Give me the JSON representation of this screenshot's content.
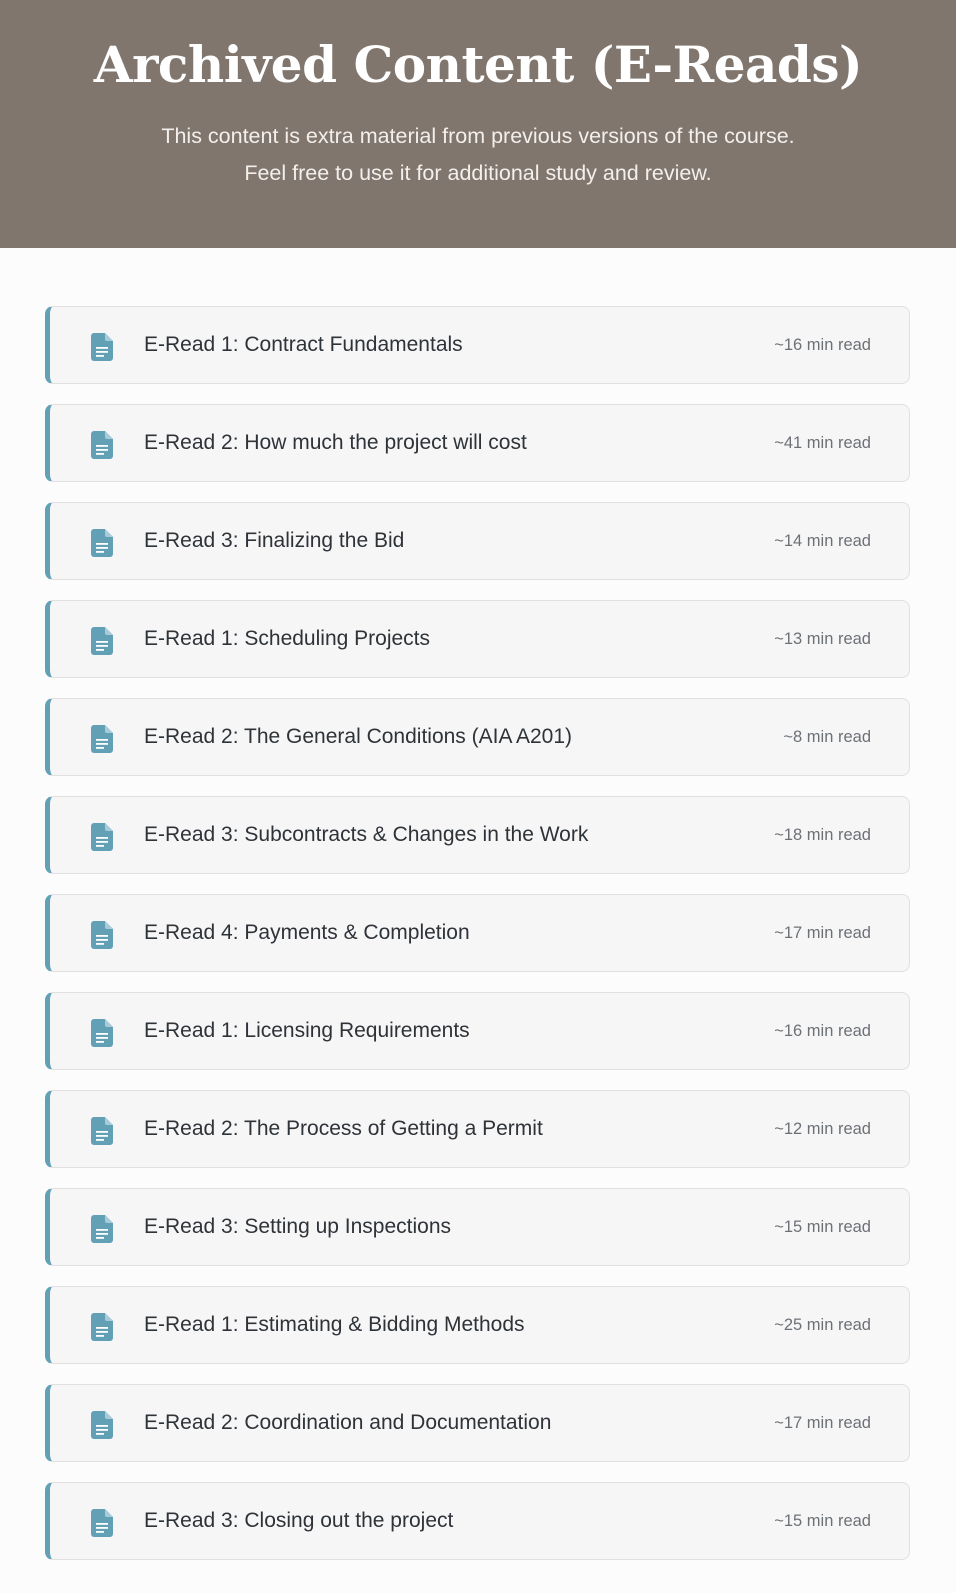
{
  "header": {
    "title": "Archived Content (E-Reads)",
    "subtitle_line1": "This content is extra material from previous versions of the course.",
    "subtitle_line2": "Feel free to use it for additional study and review."
  },
  "colors": {
    "header_bg": "#80766d",
    "accent": "#62a0b6",
    "card_bg": "#f7f6f7"
  },
  "items": [
    {
      "icon": "document-icon",
      "title": "E-Read 1: Contract Fundamentals",
      "time": "~16 min read"
    },
    {
      "icon": "document-icon",
      "title": "E-Read 2: How much the project will cost",
      "time": "~41 min read"
    },
    {
      "icon": "document-icon",
      "title": "E-Read 3: Finalizing the Bid",
      "time": "~14 min read"
    },
    {
      "icon": "document-icon",
      "title": "E-Read 1: Scheduling Projects",
      "time": "~13 min read"
    },
    {
      "icon": "document-icon",
      "title": "E-Read 2: The General Conditions (AIA A201)",
      "time": "~8 min read"
    },
    {
      "icon": "document-icon",
      "title": "E-Read 3: Subcontracts & Changes in the Work",
      "time": "~18 min read"
    },
    {
      "icon": "document-icon",
      "title": "E-Read 4: Payments & Completion",
      "time": "~17 min read"
    },
    {
      "icon": "document-icon",
      "title": "E-Read 1: Licensing Requirements",
      "time": "~16 min read"
    },
    {
      "icon": "document-icon",
      "title": "E-Read 2: The Process of Getting a Permit",
      "time": "~12 min read"
    },
    {
      "icon": "document-icon",
      "title": "E-Read 3: Setting up Inspections",
      "time": "~15 min read"
    },
    {
      "icon": "document-icon",
      "title": "E-Read 1: Estimating & Bidding Methods",
      "time": "~25 min read"
    },
    {
      "icon": "document-icon",
      "title": "E-Read 2: Coordination and Documentation",
      "time": "~17 min read"
    },
    {
      "icon": "document-icon",
      "title": "E-Read 3: Closing out the project",
      "time": "~15 min read"
    }
  ]
}
